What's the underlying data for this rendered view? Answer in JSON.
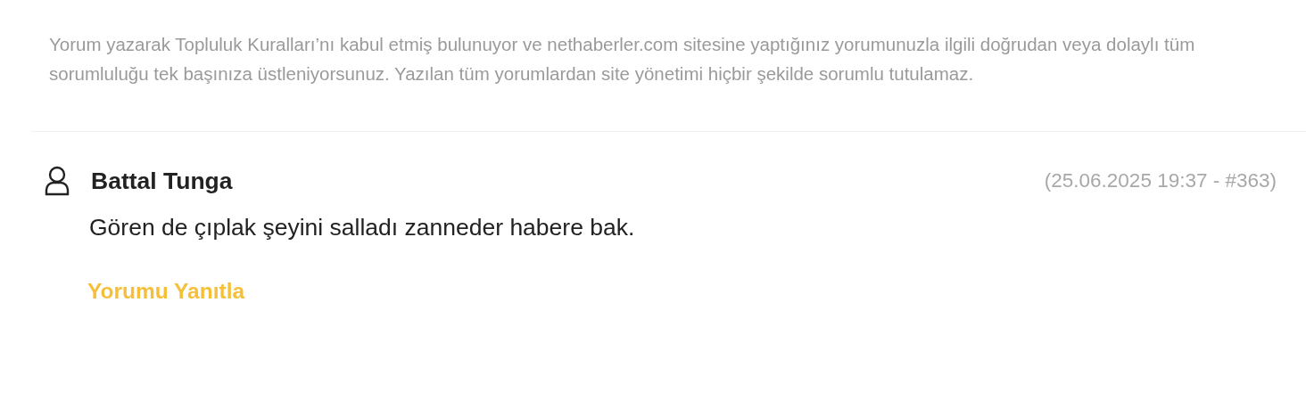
{
  "disclaimer": "Yorum yazarak Topluluk Kuralları’nı kabul etmiş bulunuyor ve nethaberler.com sitesine yaptığınız yorumunuzla ilgili doğrudan veya dolaylı tüm sorumluluğu tek başınıza üstleniyorsunuz. Yazılan tüm yorumlardan site yönetimi hiçbir şekilde sorumlu tutulamaz.",
  "comments": [
    {
      "author": "Battal Tunga",
      "meta": "(25.06.2025 19:37 - #363)",
      "text": "Gören de çıplak şeyini salladı zanneder habere bak.",
      "reply": "Yorumu Yanıtla"
    }
  ]
}
